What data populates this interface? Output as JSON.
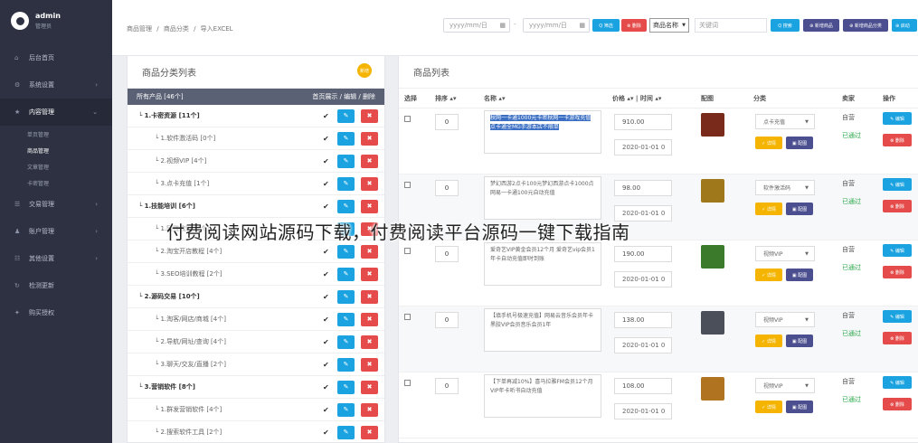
{
  "user": {
    "name": "admin",
    "role": "管理员"
  },
  "sidebar": {
    "items": [
      {
        "label": "后台首页",
        "icon": "home-icon",
        "glyph": "⌂"
      },
      {
        "label": "系统设置",
        "icon": "gear-icon",
        "glyph": "⚙"
      },
      {
        "label": "内容管理",
        "icon": "star-icon",
        "glyph": "★"
      },
      {
        "label": "交易管理",
        "icon": "list-icon",
        "glyph": "☰"
      },
      {
        "label": "账户管理",
        "icon": "user-icon",
        "glyph": "♟"
      },
      {
        "label": "其他设置",
        "icon": "menu-icon",
        "glyph": "☷"
      },
      {
        "label": "检测更新",
        "icon": "refresh-icon",
        "glyph": "↻"
      },
      {
        "label": "购买授权",
        "icon": "cart-icon",
        "glyph": "✦"
      }
    ],
    "subitems": [
      "单页管理",
      "商品管理",
      "文章管理",
      "卡密管理"
    ]
  },
  "breadcrumb": {
    "a": "商品管理",
    "sep": "/",
    "b": "商品分类",
    "c": "导入EXCEL"
  },
  "toolbar": {
    "date_placeholder": "yyyy/mm/日",
    "tilde": "-",
    "btn_search": "Q 筛选",
    "btn_delete": "⊗ 删除",
    "select_value": "商品名称",
    "keyword_placeholder": "关键词",
    "btn_search2": "Q 搜索",
    "btn_add_product": "⊕ 新增商品",
    "btn_add_category": "⊕ 新增商品分类",
    "btn_extra": "⊕ 启动"
  },
  "left_panel": {
    "title": "商品分类列表",
    "badge": "新增",
    "head_left": "所有产品 [46个]",
    "head_right": "首页展示 / 编辑 / 删除",
    "rows": [
      {
        "label": "└ 1.卡密资源 [11个]",
        "level": 1
      },
      {
        "label": "└ 1.软件激活码 [0个]",
        "level": 2
      },
      {
        "label": "└ 2.视频VIP [4个]",
        "level": 2
      },
      {
        "label": "└ 3.点卡充值 [1个]",
        "level": 2
      },
      {
        "label": "└ 1.技能培训 [6个]",
        "level": 1
      },
      {
        "label": "└ 1.网赚教程 [1个]",
        "level": 2
      },
      {
        "label": "└ 2.淘宝开店教程 [4个]",
        "level": 2
      },
      {
        "label": "└ 3.SEO培训教程 [2个]",
        "level": 2
      },
      {
        "label": "└ 2.源码交易 [10个]",
        "level": 1
      },
      {
        "label": "└ 1.淘客/网店/商城 [4个]",
        "level": 2
      },
      {
        "label": "└ 2.导航/网址/查询 [4个]",
        "level": 2
      },
      {
        "label": "└ 3.聊天/交友/直播 [2个]",
        "level": 2
      },
      {
        "label": "└ 3.营销软件 [8个]",
        "level": 1
      },
      {
        "label": "└ 1.群发营销软件 [4个]",
        "level": 2
      },
      {
        "label": "└ 2.搜索软件工具 [2个]",
        "level": 2
      }
    ]
  },
  "right_panel": {
    "title": "商品列表",
    "headers": {
      "select": "选择",
      "sort": "排序 ▴▾",
      "name": "名称 ▴▾",
      "price": "价格 ▴▾ | 时间 ▴▾",
      "image": "配图",
      "category": "分类",
      "seller": "卖家",
      "ops": "操作"
    },
    "labels": {
      "btn_detail": "✓ 详情",
      "btn_image": "▣ 配图",
      "btn_edit": "✎ 编辑",
      "btn_delete": "⊗ 删除"
    },
    "rows": [
      {
        "sort": "0",
        "name": "秋网一卡通1000元卡密秋网一卡游戏充值点卡通全MG手游本店不限单",
        "price": "910.00",
        "date": "2020-01-01 0",
        "category": "点卡充值",
        "seller": "自营",
        "status": "已通过",
        "highlight": true,
        "img_color": "#7a2a1a"
      },
      {
        "sort": "0",
        "name": "梦幻西游2点卡100元梦幻西游点卡1000点网易一卡通100元自动充值",
        "price": "98.00",
        "date": "2020-01-01 0",
        "category": "软件激活码",
        "seller": "自营",
        "status": "已通过",
        "highlight": false,
        "img_color": "#a0781c"
      },
      {
        "sort": "0",
        "name": "爱奇艺VIP黄金会员12个月 爱奇艺vip会员1年卡自动充值即时到账",
        "price": "190.00",
        "date": "2020-01-01 0",
        "category": "视频VIP",
        "seller": "自营",
        "status": "已通过",
        "highlight": false,
        "img_color": "#3a7a2a"
      },
      {
        "sort": "0",
        "name": "【填手机号极速充值】网易云音乐会员年卡黑胶VIP会员音乐会员1年",
        "price": "138.00",
        "date": "2020-01-01 0",
        "category": "视频VIP",
        "seller": "自营",
        "status": "已通过",
        "highlight": false,
        "img_color": "#4a4f5a"
      },
      {
        "sort": "0",
        "name": "【下单再减10%】喜马拉雅FM会员12个月VIP年卡听书自动充值",
        "price": "108.00",
        "date": "2020-01-01 0",
        "category": "视频VIP",
        "seller": "自营",
        "status": "已通过",
        "highlight": false,
        "img_color": "#b07420"
      }
    ]
  },
  "overlay_text": "付费阅读网站源码下载，付费阅读平台源码一键下载指南",
  "colors": {
    "sidebar": "#2d3141",
    "blue": "#1aa3e0",
    "red": "#e64b4b",
    "yellow": "#f4b400",
    "navy": "#4b4f8f",
    "green": "#2aa84a"
  }
}
